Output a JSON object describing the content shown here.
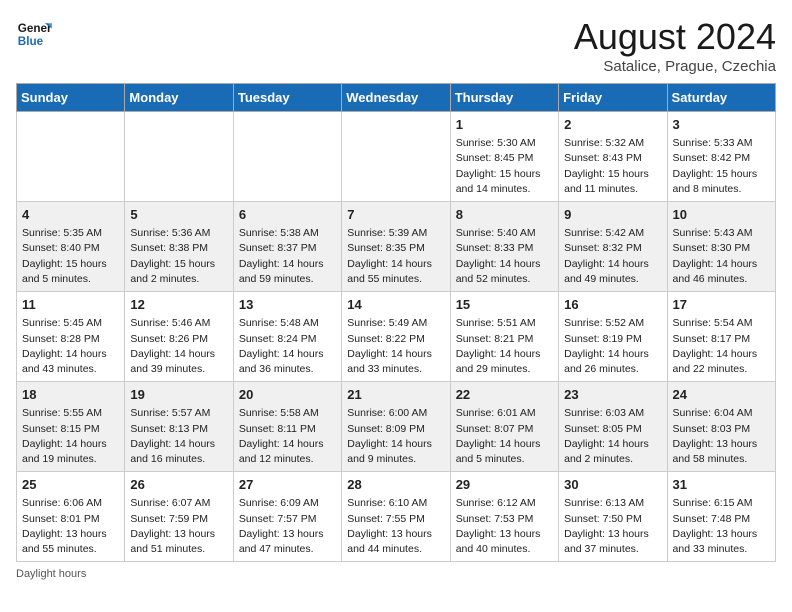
{
  "header": {
    "logo_line1": "General",
    "logo_line2": "Blue",
    "month_title": "August 2024",
    "location": "Satalice, Prague, Czechia"
  },
  "weekdays": [
    "Sunday",
    "Monday",
    "Tuesday",
    "Wednesday",
    "Thursday",
    "Friday",
    "Saturday"
  ],
  "weeks": [
    [
      {
        "day": "",
        "info": ""
      },
      {
        "day": "",
        "info": ""
      },
      {
        "day": "",
        "info": ""
      },
      {
        "day": "",
        "info": ""
      },
      {
        "day": "1",
        "info": "Sunrise: 5:30 AM\nSunset: 8:45 PM\nDaylight: 15 hours\nand 14 minutes."
      },
      {
        "day": "2",
        "info": "Sunrise: 5:32 AM\nSunset: 8:43 PM\nDaylight: 15 hours\nand 11 minutes."
      },
      {
        "day": "3",
        "info": "Sunrise: 5:33 AM\nSunset: 8:42 PM\nDaylight: 15 hours\nand 8 minutes."
      }
    ],
    [
      {
        "day": "4",
        "info": "Sunrise: 5:35 AM\nSunset: 8:40 PM\nDaylight: 15 hours\nand 5 minutes."
      },
      {
        "day": "5",
        "info": "Sunrise: 5:36 AM\nSunset: 8:38 PM\nDaylight: 15 hours\nand 2 minutes."
      },
      {
        "day": "6",
        "info": "Sunrise: 5:38 AM\nSunset: 8:37 PM\nDaylight: 14 hours\nand 59 minutes."
      },
      {
        "day": "7",
        "info": "Sunrise: 5:39 AM\nSunset: 8:35 PM\nDaylight: 14 hours\nand 55 minutes."
      },
      {
        "day": "8",
        "info": "Sunrise: 5:40 AM\nSunset: 8:33 PM\nDaylight: 14 hours\nand 52 minutes."
      },
      {
        "day": "9",
        "info": "Sunrise: 5:42 AM\nSunset: 8:32 PM\nDaylight: 14 hours\nand 49 minutes."
      },
      {
        "day": "10",
        "info": "Sunrise: 5:43 AM\nSunset: 8:30 PM\nDaylight: 14 hours\nand 46 minutes."
      }
    ],
    [
      {
        "day": "11",
        "info": "Sunrise: 5:45 AM\nSunset: 8:28 PM\nDaylight: 14 hours\nand 43 minutes."
      },
      {
        "day": "12",
        "info": "Sunrise: 5:46 AM\nSunset: 8:26 PM\nDaylight: 14 hours\nand 39 minutes."
      },
      {
        "day": "13",
        "info": "Sunrise: 5:48 AM\nSunset: 8:24 PM\nDaylight: 14 hours\nand 36 minutes."
      },
      {
        "day": "14",
        "info": "Sunrise: 5:49 AM\nSunset: 8:22 PM\nDaylight: 14 hours\nand 33 minutes."
      },
      {
        "day": "15",
        "info": "Sunrise: 5:51 AM\nSunset: 8:21 PM\nDaylight: 14 hours\nand 29 minutes."
      },
      {
        "day": "16",
        "info": "Sunrise: 5:52 AM\nSunset: 8:19 PM\nDaylight: 14 hours\nand 26 minutes."
      },
      {
        "day": "17",
        "info": "Sunrise: 5:54 AM\nSunset: 8:17 PM\nDaylight: 14 hours\nand 22 minutes."
      }
    ],
    [
      {
        "day": "18",
        "info": "Sunrise: 5:55 AM\nSunset: 8:15 PM\nDaylight: 14 hours\nand 19 minutes."
      },
      {
        "day": "19",
        "info": "Sunrise: 5:57 AM\nSunset: 8:13 PM\nDaylight: 14 hours\nand 16 minutes."
      },
      {
        "day": "20",
        "info": "Sunrise: 5:58 AM\nSunset: 8:11 PM\nDaylight: 14 hours\nand 12 minutes."
      },
      {
        "day": "21",
        "info": "Sunrise: 6:00 AM\nSunset: 8:09 PM\nDaylight: 14 hours\nand 9 minutes."
      },
      {
        "day": "22",
        "info": "Sunrise: 6:01 AM\nSunset: 8:07 PM\nDaylight: 14 hours\nand 5 minutes."
      },
      {
        "day": "23",
        "info": "Sunrise: 6:03 AM\nSunset: 8:05 PM\nDaylight: 14 hours\nand 2 minutes."
      },
      {
        "day": "24",
        "info": "Sunrise: 6:04 AM\nSunset: 8:03 PM\nDaylight: 13 hours\nand 58 minutes."
      }
    ],
    [
      {
        "day": "25",
        "info": "Sunrise: 6:06 AM\nSunset: 8:01 PM\nDaylight: 13 hours\nand 55 minutes."
      },
      {
        "day": "26",
        "info": "Sunrise: 6:07 AM\nSunset: 7:59 PM\nDaylight: 13 hours\nand 51 minutes."
      },
      {
        "day": "27",
        "info": "Sunrise: 6:09 AM\nSunset: 7:57 PM\nDaylight: 13 hours\nand 47 minutes."
      },
      {
        "day": "28",
        "info": "Sunrise: 6:10 AM\nSunset: 7:55 PM\nDaylight: 13 hours\nand 44 minutes."
      },
      {
        "day": "29",
        "info": "Sunrise: 6:12 AM\nSunset: 7:53 PM\nDaylight: 13 hours\nand 40 minutes."
      },
      {
        "day": "30",
        "info": "Sunrise: 6:13 AM\nSunset: 7:50 PM\nDaylight: 13 hours\nand 37 minutes."
      },
      {
        "day": "31",
        "info": "Sunrise: 6:15 AM\nSunset: 7:48 PM\nDaylight: 13 hours\nand 33 minutes."
      }
    ]
  ],
  "footer": "Daylight hours"
}
